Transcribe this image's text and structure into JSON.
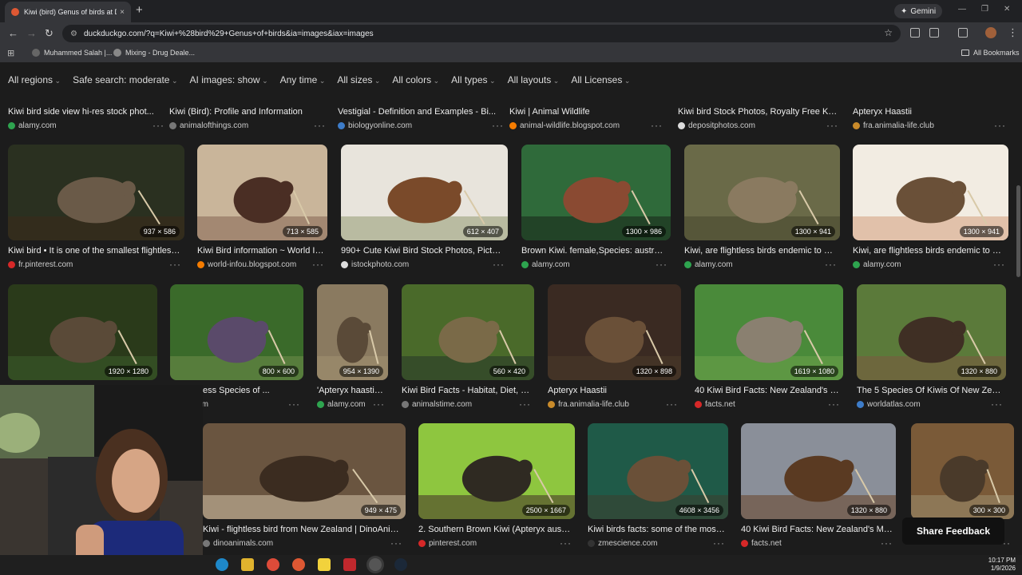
{
  "tab": {
    "title": "Kiwi (bird) Genus of birds at DuckDuckGo",
    "close": "×",
    "new": "+"
  },
  "gemini_label": "Gemini",
  "window_controls": {
    "min": "—",
    "max": "❐",
    "close": "✕"
  },
  "nav": {
    "back": "←",
    "forward": "→",
    "reload": "↻"
  },
  "url": "duckduckgo.com/?q=Kiwi+%28bird%29+Genus+of+birds&ia=images&iax=images",
  "bookmarks": {
    "item1": "Muhammed Salah |...",
    "item2": "Mixing - Drug Deale...",
    "all": "All Bookmarks"
  },
  "filters": [
    "All regions",
    "Safe search: moderate",
    "AI images: show",
    "Any time",
    "All sizes",
    "All colors",
    "All types",
    "All layouts",
    "All Licenses"
  ],
  "row1": [
    {
      "title": "Kiwi bird side view hi-res stock phot...",
      "source": "alamy.com",
      "color": "#2ea44f"
    },
    {
      "title": "Kiwi (Bird): Profile and Information",
      "source": "animalofthings.com",
      "color": "#777777"
    },
    {
      "title": "Vestigial - Definition and Examples - Bi...",
      "source": "biologyonline.com",
      "color": "#3d7cc9"
    },
    {
      "title": "Kiwi | Animal Wildlife",
      "source": "animal-wildlife.blogspot.com",
      "color": "#f57c00"
    },
    {
      "title": "Kiwi bird Stock Photos, Royalty Free Kiw...",
      "source": "depositphotos.com",
      "color": "#dddddd"
    },
    {
      "title": "Apteryx Haastii",
      "source": "fra.animalia-life.club",
      "color": "#c88a2a"
    }
  ],
  "row2": [
    {
      "title": "Kiwi bird • It is one of the smallest flightless ...",
      "source": "fr.pinterest.com",
      "dims": "937 × 586",
      "color": "#d62828"
    },
    {
      "title": "Kiwi Bird information ~ World Info",
      "source": "world-infou.blogspot.com",
      "dims": "713 × 585",
      "color": "#f57c00"
    },
    {
      "title": "990+ Cute Kiwi Bird Stock Photos, Pictur...",
      "source": "istockphoto.com",
      "dims": "612 × 407",
      "color": "#dddddd"
    },
    {
      "title": "Brown Kiwi. female,Species: australis...",
      "source": "alamy.com",
      "dims": "1300 × 986",
      "color": "#2ea44f"
    },
    {
      "title": "Kiwi, are flightless birds endemic to N...",
      "source": "alamy.com",
      "dims": "1300 × 941",
      "color": "#2ea44f"
    },
    {
      "title": "Kiwi, are flightless birds endemic to N...",
      "source": "alamy.com",
      "dims": "1300 × 941",
      "color": "#2ea44f"
    }
  ],
  "row3": [
    {
      "title": "",
      "source": "",
      "dims": "1920 × 1280",
      "color": "#777777"
    },
    {
      "title": "s: Flightless Species of ...",
      "source": "est.com",
      "dims": "800 × 600",
      "color": "#d62828"
    },
    {
      "title": "'Apteryx haastii,' ...",
      "source": "alamy.com",
      "dims": "954 × 1390",
      "color": "#2ea44f"
    },
    {
      "title": "Kiwi Bird Facts - Habitat, Diet, E...",
      "source": "animalstime.com",
      "dims": "560 × 420",
      "color": "#777777"
    },
    {
      "title": "Apteryx Haastii",
      "source": "fra.animalia-life.club",
      "dims": "1320 × 898",
      "color": "#c88a2a"
    },
    {
      "title": "40 Kiwi Bird Facts: New Zealand's M...",
      "source": "facts.net",
      "dims": "1619 × 1080",
      "color": "#d62828"
    },
    {
      "title": "The 5 Species Of Kiwis Of New Zeala...",
      "source": "worldatlas.com",
      "dims": "1320 × 880",
      "color": "#3d7cc9"
    }
  ],
  "row4": [
    {
      "title": "Kiwi - flightless bird from New Zealand | DinoAnima...",
      "source": "dinoanimals.com",
      "dims": "949 × 475",
      "color": "#777777"
    },
    {
      "title": "2. Southern Brown Kiwi (Apteryx austr...",
      "source": "pinterest.com",
      "dims": "2500 × 1667",
      "color": "#d62828"
    },
    {
      "title": "Kiwi birds facts: some of the most ...",
      "source": "zmescience.com",
      "dims": "4608 × 3456",
      "color": "#333333"
    },
    {
      "title": "40 Kiwi Bird Facts: New Zealand's Mos...",
      "source": "facts.net",
      "dims": "1320 × 880",
      "color": "#d62828"
    },
    {
      "title": "",
      "source": "",
      "dims": "300 × 300",
      "color": "#777777"
    }
  ],
  "share_feedback": "Share Feedback",
  "more_icon": "···",
  "clock": {
    "time": "10:17 PM",
    "date": "1/9/2026"
  }
}
